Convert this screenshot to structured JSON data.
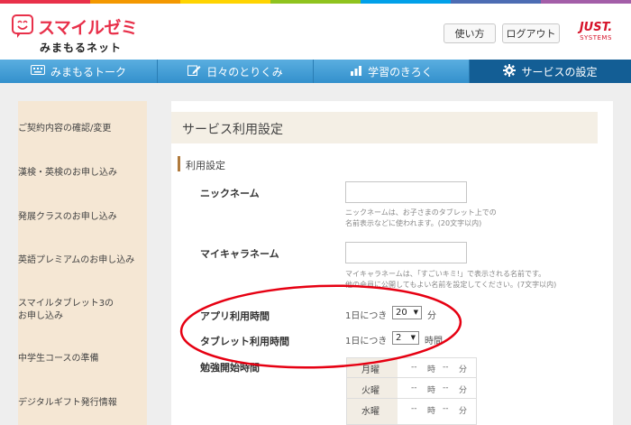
{
  "colors": {
    "rainbow": [
      "#e8304a",
      "#f39800",
      "#ffd400",
      "#8fc31f",
      "#00a0e9",
      "#4c6cb3",
      "#a35ea8"
    ],
    "brand_red": "#e8304a",
    "nav_blue": "#3390cc",
    "nav_active": "#135e95",
    "sidebar_bg": "#f5e7d4",
    "annotation_red": "#e60012"
  },
  "header": {
    "logo_main": "スマイルゼミ",
    "logo_sub": "みまもるネット",
    "usage_button": "使い方",
    "logout_button": "ログアウト",
    "just_logo": "JUST.",
    "just_sub": "SYSTEMS"
  },
  "nav": {
    "tabs": [
      {
        "label": "みまもるトーク",
        "icon": "keyboard-icon"
      },
      {
        "label": "日々のとりくみ",
        "icon": "pencil-icon"
      },
      {
        "label": "学習のきろく",
        "icon": "bar-chart-icon"
      },
      {
        "label": "サービスの設定",
        "icon": "gear-icon",
        "active": true
      }
    ]
  },
  "sidebar": {
    "items": [
      {
        "label": "ご契約内容の確認/変更"
      },
      {
        "label": "漢検・英検のお申し込み"
      },
      {
        "label": "発展クラスのお申し込み"
      },
      {
        "label": "英語プレミアムのお申し込み"
      },
      {
        "label": "スマイルタブレット3の",
        "label2": "お申し込み"
      },
      {
        "label": "中学生コースの準備"
      },
      {
        "label": "デジタルギフト発行情報"
      }
    ]
  },
  "main": {
    "title": "サービス利用設定",
    "section": "利用設定",
    "nickname": {
      "label": "ニックネーム",
      "value": "",
      "hint1": "ニックネームは、お子さまのタブレット上での",
      "hint2": "名前表示などに使われます。(20文字以内)"
    },
    "character_name": {
      "label": "マイキャラネーム",
      "value": "",
      "hint1": "マイキャラネームは、「すごいキミ!」で表示される名前です。",
      "hint2": "他の会員に公開してもよい名前を設定してください。(7文字以内)"
    },
    "app_time": {
      "label": "アプリ利用時間",
      "prefix": "1日につき",
      "value": "20",
      "unit": "分"
    },
    "tablet_time": {
      "label": "タブレット利用時間",
      "prefix": "1日につき",
      "value": "2",
      "unit": "時間"
    },
    "study_start": {
      "label": "勉強開始時間",
      "hour_unit": "時",
      "minute_unit": "分",
      "placeholder": "--",
      "days": [
        "月曜",
        "火曜",
        "水曜"
      ]
    }
  }
}
